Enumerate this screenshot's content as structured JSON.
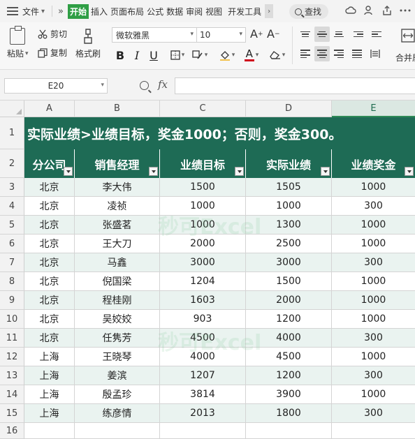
{
  "menubar": {
    "file_label": "文件",
    "more_label": "»",
    "tabs": [
      "开始",
      "插入",
      "页面布局",
      "公式",
      "数据",
      "审阅",
      "视图",
      "开发工具"
    ],
    "search_label": "查找"
  },
  "ribbon": {
    "paste_label": "粘贴",
    "cut_label": "剪切",
    "copy_label": "复制",
    "format_painter_label": "格式刷",
    "font_name": "微软雅黑",
    "font_size": "10",
    "merge_label": "合并居"
  },
  "formula_bar": {
    "cell_ref": "E20",
    "fx_label": "fx",
    "value": ""
  },
  "sheet": {
    "columns": [
      "A",
      "B",
      "C",
      "D",
      "E"
    ],
    "rows": [
      "1",
      "2",
      "3",
      "4",
      "5",
      "6",
      "7",
      "8",
      "9",
      "10",
      "11",
      "12",
      "13",
      "14",
      "15",
      "16"
    ],
    "title": "实际业绩>业绩目标，奖金1000；否则，奖金300。",
    "headers": [
      "分公司",
      "销售经理",
      "业绩目标",
      "实际业绩",
      "业绩奖金"
    ],
    "data": [
      [
        "北京",
        "李大伟",
        "1500",
        "1505",
        "1000"
      ],
      [
        "北京",
        "凌祯",
        "1000",
        "1000",
        "300"
      ],
      [
        "北京",
        "张盛茗",
        "1000",
        "1300",
        "1000"
      ],
      [
        "北京",
        "王大刀",
        "2000",
        "2500",
        "1000"
      ],
      [
        "北京",
        "马鑫",
        "3000",
        "3000",
        "300"
      ],
      [
        "北京",
        "倪国梁",
        "1204",
        "1500",
        "1000"
      ],
      [
        "北京",
        "程桂刚",
        "1603",
        "2000",
        "1000"
      ],
      [
        "北京",
        "吴姣姣",
        "903",
        "1200",
        "1000"
      ],
      [
        "北京",
        "任隽芳",
        "4500",
        "4000",
        "300"
      ],
      [
        "上海",
        "王晓琴",
        "4000",
        "4500",
        "1000"
      ],
      [
        "上海",
        "姜滨",
        "1207",
        "1200",
        "300"
      ],
      [
        "上海",
        "殷孟珍",
        "3814",
        "3900",
        "1000"
      ],
      [
        "上海",
        "练彦情",
        "2013",
        "1800",
        "300"
      ]
    ]
  },
  "watermark": "秒可Excel",
  "colors": {
    "accent": "#2f9e45",
    "header_fill": "#1e6b55",
    "band_fill": "#eaf3f0"
  }
}
